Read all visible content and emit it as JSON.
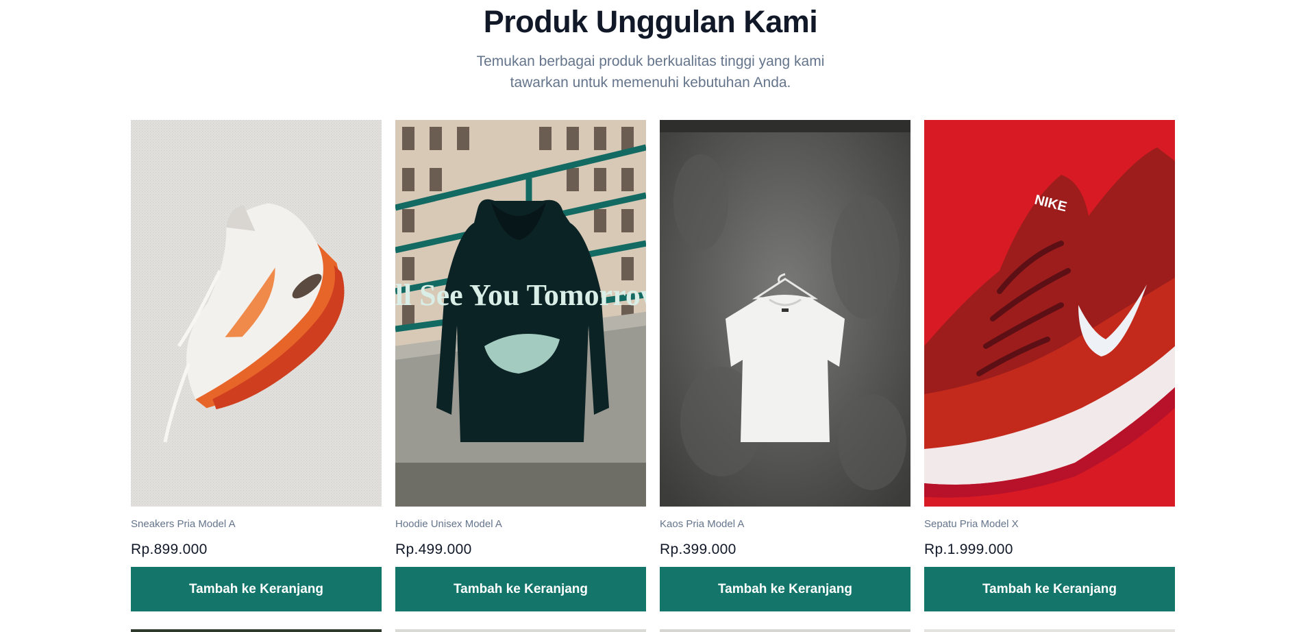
{
  "section": {
    "title": "Produk Unggulan Kami",
    "subtitle": "Temukan berbagai produk berkualitas tinggi yang kami tawarkan untuk memenuhi kebutuhan Anda."
  },
  "products": [
    {
      "name": "Sneakers Pria Model A",
      "price": "Rp.899.000",
      "button": "Tambah ke Keranjang"
    },
    {
      "name": "Hoodie Unisex Model A",
      "price": "Rp.499.000",
      "button": "Tambah ke Keranjang"
    },
    {
      "name": "Kaos Pria Model A",
      "price": "Rp.399.000",
      "button": "Tambah ke Keranjang"
    },
    {
      "name": "Sepatu Pria Model X",
      "price": "Rp.1.999.000",
      "button": "Tambah ke Keranjang"
    }
  ],
  "images": {
    "image_1_text": "I'll See You Tomorrow",
    "image_3_brand": "NIKE"
  },
  "colors": {
    "button": "#14766b",
    "title": "#111827",
    "subtitle": "#64748b"
  }
}
